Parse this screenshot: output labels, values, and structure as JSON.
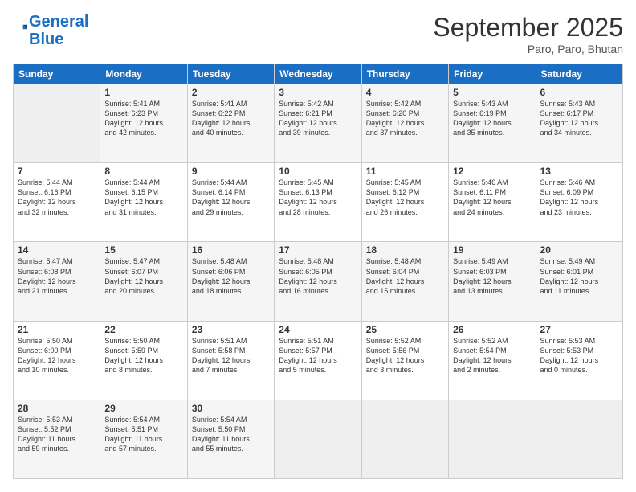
{
  "header": {
    "logo_line1": "General",
    "logo_line2": "Blue",
    "month": "September 2025",
    "location": "Paro, Paro, Bhutan"
  },
  "weekdays": [
    "Sunday",
    "Monday",
    "Tuesday",
    "Wednesday",
    "Thursday",
    "Friday",
    "Saturday"
  ],
  "weeks": [
    [
      {
        "day": "",
        "info": ""
      },
      {
        "day": "1",
        "info": "Sunrise: 5:41 AM\nSunset: 6:23 PM\nDaylight: 12 hours\nand 42 minutes."
      },
      {
        "day": "2",
        "info": "Sunrise: 5:41 AM\nSunset: 6:22 PM\nDaylight: 12 hours\nand 40 minutes."
      },
      {
        "day": "3",
        "info": "Sunrise: 5:42 AM\nSunset: 6:21 PM\nDaylight: 12 hours\nand 39 minutes."
      },
      {
        "day": "4",
        "info": "Sunrise: 5:42 AM\nSunset: 6:20 PM\nDaylight: 12 hours\nand 37 minutes."
      },
      {
        "day": "5",
        "info": "Sunrise: 5:43 AM\nSunset: 6:19 PM\nDaylight: 12 hours\nand 35 minutes."
      },
      {
        "day": "6",
        "info": "Sunrise: 5:43 AM\nSunset: 6:17 PM\nDaylight: 12 hours\nand 34 minutes."
      }
    ],
    [
      {
        "day": "7",
        "info": "Sunrise: 5:44 AM\nSunset: 6:16 PM\nDaylight: 12 hours\nand 32 minutes."
      },
      {
        "day": "8",
        "info": "Sunrise: 5:44 AM\nSunset: 6:15 PM\nDaylight: 12 hours\nand 31 minutes."
      },
      {
        "day": "9",
        "info": "Sunrise: 5:44 AM\nSunset: 6:14 PM\nDaylight: 12 hours\nand 29 minutes."
      },
      {
        "day": "10",
        "info": "Sunrise: 5:45 AM\nSunset: 6:13 PM\nDaylight: 12 hours\nand 28 minutes."
      },
      {
        "day": "11",
        "info": "Sunrise: 5:45 AM\nSunset: 6:12 PM\nDaylight: 12 hours\nand 26 minutes."
      },
      {
        "day": "12",
        "info": "Sunrise: 5:46 AM\nSunset: 6:11 PM\nDaylight: 12 hours\nand 24 minutes."
      },
      {
        "day": "13",
        "info": "Sunrise: 5:46 AM\nSunset: 6:09 PM\nDaylight: 12 hours\nand 23 minutes."
      }
    ],
    [
      {
        "day": "14",
        "info": "Sunrise: 5:47 AM\nSunset: 6:08 PM\nDaylight: 12 hours\nand 21 minutes."
      },
      {
        "day": "15",
        "info": "Sunrise: 5:47 AM\nSunset: 6:07 PM\nDaylight: 12 hours\nand 20 minutes."
      },
      {
        "day": "16",
        "info": "Sunrise: 5:48 AM\nSunset: 6:06 PM\nDaylight: 12 hours\nand 18 minutes."
      },
      {
        "day": "17",
        "info": "Sunrise: 5:48 AM\nSunset: 6:05 PM\nDaylight: 12 hours\nand 16 minutes."
      },
      {
        "day": "18",
        "info": "Sunrise: 5:48 AM\nSunset: 6:04 PM\nDaylight: 12 hours\nand 15 minutes."
      },
      {
        "day": "19",
        "info": "Sunrise: 5:49 AM\nSunset: 6:03 PM\nDaylight: 12 hours\nand 13 minutes."
      },
      {
        "day": "20",
        "info": "Sunrise: 5:49 AM\nSunset: 6:01 PM\nDaylight: 12 hours\nand 11 minutes."
      }
    ],
    [
      {
        "day": "21",
        "info": "Sunrise: 5:50 AM\nSunset: 6:00 PM\nDaylight: 12 hours\nand 10 minutes."
      },
      {
        "day": "22",
        "info": "Sunrise: 5:50 AM\nSunset: 5:59 PM\nDaylight: 12 hours\nand 8 minutes."
      },
      {
        "day": "23",
        "info": "Sunrise: 5:51 AM\nSunset: 5:58 PM\nDaylight: 12 hours\nand 7 minutes."
      },
      {
        "day": "24",
        "info": "Sunrise: 5:51 AM\nSunset: 5:57 PM\nDaylight: 12 hours\nand 5 minutes."
      },
      {
        "day": "25",
        "info": "Sunrise: 5:52 AM\nSunset: 5:56 PM\nDaylight: 12 hours\nand 3 minutes."
      },
      {
        "day": "26",
        "info": "Sunrise: 5:52 AM\nSunset: 5:54 PM\nDaylight: 12 hours\nand 2 minutes."
      },
      {
        "day": "27",
        "info": "Sunrise: 5:53 AM\nSunset: 5:53 PM\nDaylight: 12 hours\nand 0 minutes."
      }
    ],
    [
      {
        "day": "28",
        "info": "Sunrise: 5:53 AM\nSunset: 5:52 PM\nDaylight: 11 hours\nand 59 minutes."
      },
      {
        "day": "29",
        "info": "Sunrise: 5:54 AM\nSunset: 5:51 PM\nDaylight: 11 hours\nand 57 minutes."
      },
      {
        "day": "30",
        "info": "Sunrise: 5:54 AM\nSunset: 5:50 PM\nDaylight: 11 hours\nand 55 minutes."
      },
      {
        "day": "",
        "info": ""
      },
      {
        "day": "",
        "info": ""
      },
      {
        "day": "",
        "info": ""
      },
      {
        "day": "",
        "info": ""
      }
    ]
  ]
}
